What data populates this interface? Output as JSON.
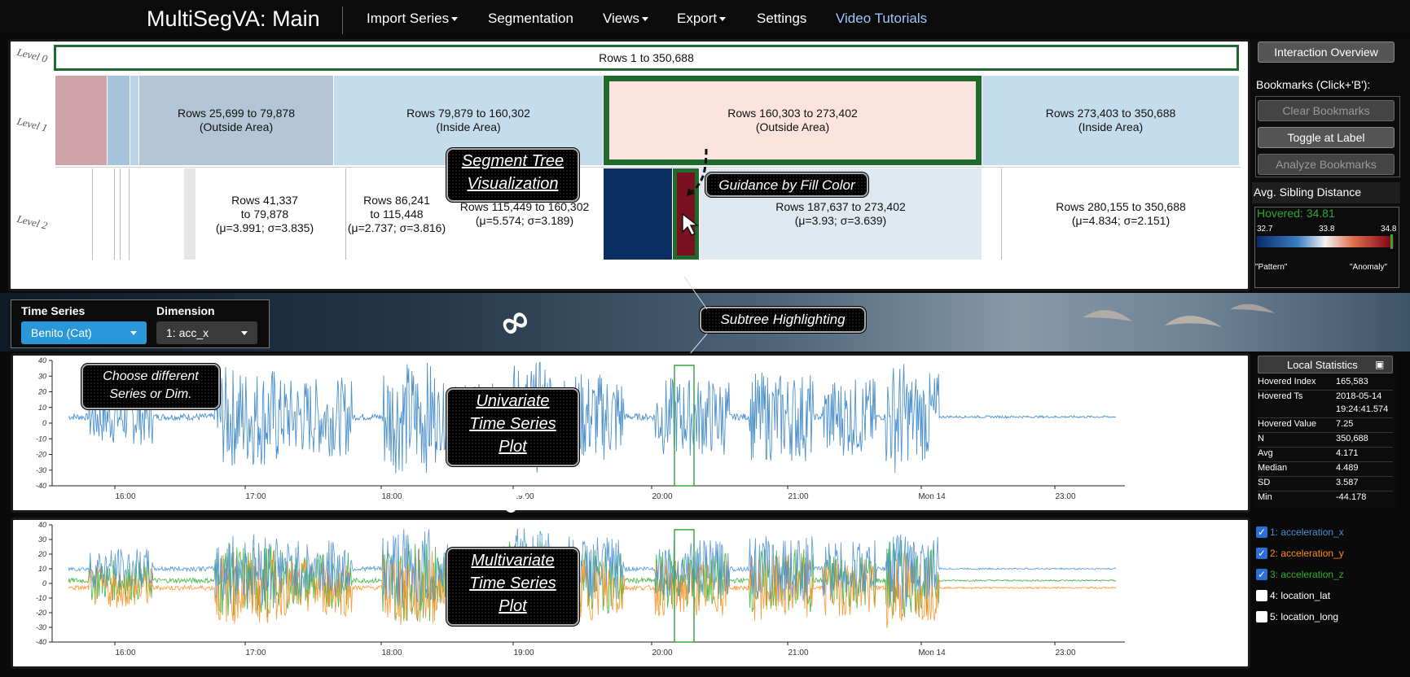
{
  "header": {
    "brand": "MultiSegVA: Main",
    "menu": [
      {
        "label": "Import Series",
        "dropdown": true
      },
      {
        "label": "Segmentation",
        "dropdown": false
      },
      {
        "label": "Views",
        "dropdown": true
      },
      {
        "label": "Export",
        "dropdown": true
      },
      {
        "label": "Settings",
        "dropdown": false
      },
      {
        "label": "Video Tutorials",
        "dropdown": false
      }
    ]
  },
  "tree": {
    "levels": [
      "Level 0",
      "Level 1",
      "Level 2"
    ],
    "level0": "Rows 1 to 350,688",
    "level1": [
      {
        "rows": "Rows 25,699 to 79,878",
        "area": "(Outside Area)"
      },
      {
        "rows": "Rows 79,879 to 160,302",
        "area": "(Inside Area)"
      },
      {
        "rows": "Rows 160,303 to 273,402",
        "area": "(Outside Area)"
      },
      {
        "rows": "Rows 273,403 to 350,688",
        "area": "(Inside Area)"
      }
    ],
    "level2": [
      {
        "l1": "Rows 41,337",
        "l2": "to 79,878",
        "l3": "(μ=3.991; σ=3.835)"
      },
      {
        "l1": "Rows 86,241",
        "l2": "to 115,448",
        "l3": "(μ=2.737; σ=3.816)"
      },
      {
        "l1": "Rows 115,449 to 160,302",
        "l2": "(μ=5.574; σ=3.189)"
      },
      {
        "l1": "Rows 187,637 to 273,402",
        "l2": "(μ=3.93; σ=3.639)"
      },
      {
        "l1": "Rows 280,155 to 350,688",
        "l2": "(μ=4.834; σ=2.151)"
      }
    ]
  },
  "callouts": {
    "segment_tree": [
      "Segment Tree",
      "Visualization"
    ],
    "guidance": "Guidance by Fill Color",
    "subtree": "Subtree Highlighting",
    "choose": [
      "Choose different",
      "Series or Dim."
    ],
    "univariate": [
      "Univariate",
      "Time Series",
      "Plot"
    ],
    "multivariate": [
      "Multivariate",
      "Time Series",
      "Plot"
    ]
  },
  "sidebar": {
    "interaction_overview": "Interaction Overview",
    "bookmarks_title": "Bookmarks (Click+'B'):",
    "clear": "Clear Bookmarks",
    "toggle": "Toggle at Label",
    "analyze": "Analyze Bookmarks",
    "sibling_title": "Avg. Sibling Distance",
    "hovered": "Hovered: 34.81",
    "scale_ticks": [
      "32.7",
      "33.8",
      "34.8"
    ],
    "pattern": "\"Pattern\"",
    "anomaly": "\"Anomaly\""
  },
  "controls": {
    "ts_label": "Time Series",
    "dim_label": "Dimension",
    "ts_value": "Benito (Cat)",
    "dim_value": "1: acc_x"
  },
  "stats": {
    "title": "Local Statistics",
    "rows": [
      [
        "Hovered Index",
        "165,583"
      ],
      [
        "Hovered Ts",
        "2018-05-14"
      ],
      [
        "",
        "19:24:41.574"
      ],
      [
        "Hovered Value",
        "7.25"
      ],
      [
        "N",
        "350,688"
      ],
      [
        "Avg",
        "4.171"
      ],
      [
        "Median",
        "4.489"
      ],
      [
        "SD",
        "3.587"
      ],
      [
        "Min",
        "-44.178"
      ]
    ]
  },
  "dims": [
    {
      "label": "1: acceleration_x",
      "checked": true,
      "color": "#4a8fd0"
    },
    {
      "label": "2: acceleration_y",
      "checked": true,
      "color": "#ff8c1a"
    },
    {
      "label": "3: acceleration_z",
      "checked": true,
      "color": "#2fb12f"
    },
    {
      "label": "4: location_lat",
      "checked": false,
      "color": "#ffffff"
    },
    {
      "label": "5: location_long",
      "checked": false,
      "color": "#ffffff"
    }
  ],
  "chart_data": [
    {
      "type": "line",
      "title": "",
      "yticks": [
        "40",
        "30",
        "20",
        "10",
        "0",
        "-10",
        "-20",
        "-30",
        "-40"
      ],
      "ylim": [
        -40,
        40
      ],
      "xticks": [
        "16:00",
        "17:00",
        "18:00",
        "19:00",
        "20:00",
        "21:00",
        "Mon 14",
        "23:00"
      ],
      "series": [
        {
          "color": "#3b86c6"
        }
      ]
    },
    {
      "type": "line",
      "title": "",
      "yticks": [
        "40",
        "30",
        "20",
        "10",
        "0",
        "-10",
        "-20",
        "-30",
        "-40"
      ],
      "ylim": [
        -40,
        40
      ],
      "xticks": [
        "16:00",
        "17:00",
        "18:00",
        "19:00",
        "20:00",
        "21:00",
        "Mon 14",
        "23:00"
      ],
      "series": [
        {
          "name": "1: acceleration_x",
          "color": "#4a8fd0"
        },
        {
          "name": "2: acceleration_y",
          "color": "#ff8c1a"
        },
        {
          "name": "3: acceleration_z",
          "color": "#2fb12f"
        }
      ]
    }
  ]
}
